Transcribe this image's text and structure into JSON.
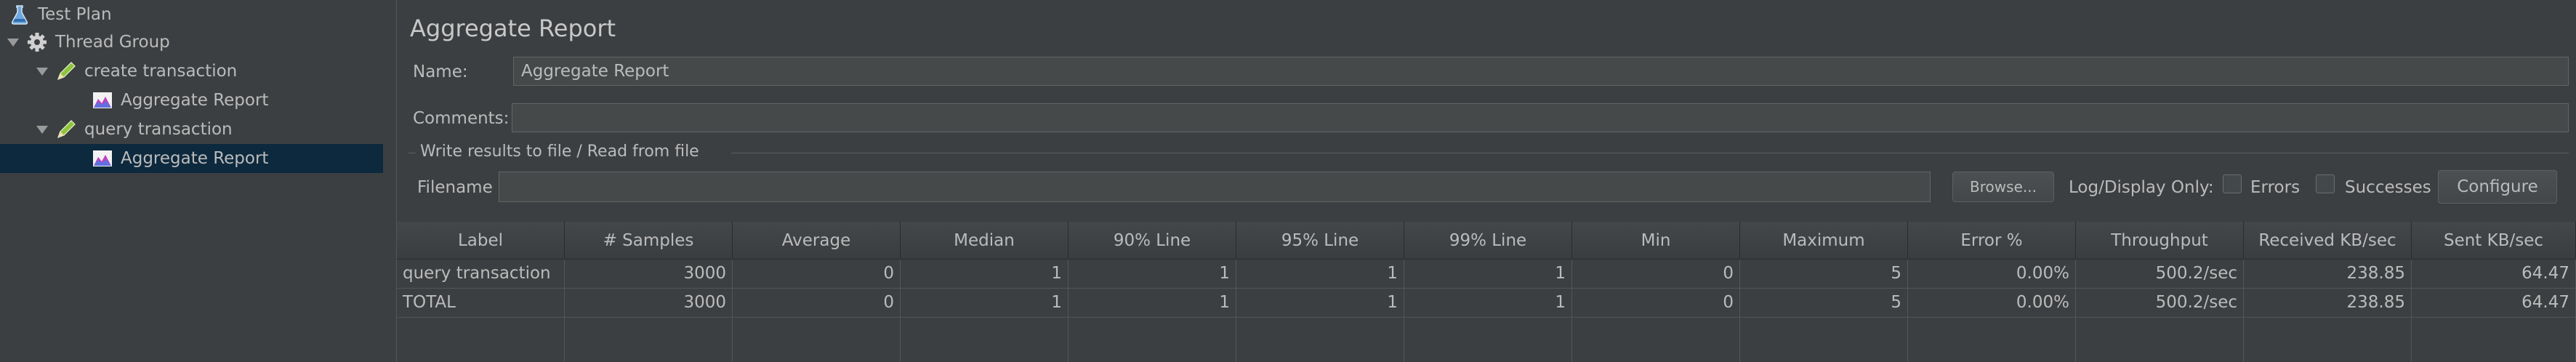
{
  "tree": {
    "items": [
      {
        "label": "Test Plan",
        "icon": "flask-icon",
        "expanded": null,
        "selected": false
      },
      {
        "label": "Thread Group",
        "icon": "gear-icon",
        "expanded": true,
        "selected": false
      },
      {
        "label": "create transaction",
        "icon": "pen-icon",
        "expanded": true,
        "selected": false
      },
      {
        "label": "Aggregate Report",
        "icon": "chart-icon",
        "expanded": null,
        "selected": false
      },
      {
        "label": "query transaction",
        "icon": "pen-icon",
        "expanded": true,
        "selected": false
      },
      {
        "label": "Aggregate Report",
        "icon": "chart-icon",
        "expanded": null,
        "selected": true
      }
    ]
  },
  "panel": {
    "title": "Aggregate Report",
    "name_label": "Name:",
    "name_value": "Aggregate Report",
    "comments_label": "Comments:",
    "comments_value": "",
    "write_results_title": "Write results to file / Read from file",
    "filename_label": "Filename",
    "filename_value": "",
    "browse_label": "Browse...",
    "log_display_label": "Log/Display Only:",
    "errors_label": "Errors",
    "errors_checked": false,
    "successes_label": "Successes",
    "successes_checked": false,
    "configure_label": "Configure"
  },
  "table": {
    "columns": [
      "Label",
      "# Samples",
      "Average",
      "Median",
      "90% Line",
      "95% Line",
      "99% Line",
      "Min",
      "Maximum",
      "Error %",
      "Throughput",
      "Received KB/sec",
      "Sent KB/sec"
    ],
    "rows": [
      [
        "query transaction",
        "3000",
        "0",
        "1",
        "1",
        "1",
        "1",
        "0",
        "5",
        "0.00%",
        "500.2/sec",
        "238.85",
        "64.47"
      ],
      [
        "TOTAL",
        "3000",
        "0",
        "1",
        "1",
        "1",
        "1",
        "0",
        "5",
        "0.00%",
        "500.2/sec",
        "238.85",
        "64.47"
      ]
    ]
  },
  "colors": {
    "background": "#3c3f41",
    "selection": "#0d293e",
    "text": "#bbbbbb"
  }
}
